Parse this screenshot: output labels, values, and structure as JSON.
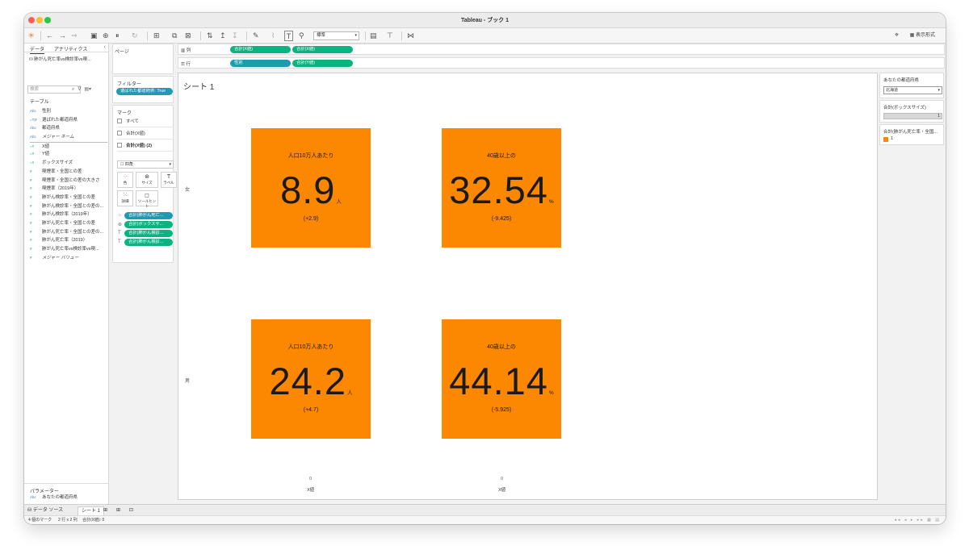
{
  "window": {
    "title": "Tableau - ブック 1"
  },
  "toolbar": {
    "font_select": "標準",
    "show_me": "表示形式"
  },
  "left": {
    "tabs": [
      "データ",
      "アナリティクス"
    ],
    "datasource": "肺がん死亡率vs検診率vs喫...",
    "search_placeholder": "検索",
    "table_title": "テーブル",
    "fields": [
      {
        "type": "Abc",
        "name": "性別"
      },
      {
        "type": "=T|F",
        "name": "選ばれた都道府県"
      },
      {
        "type": "Abc",
        "name": "都道府県"
      },
      {
        "type": "Abc",
        "name": "メジャー ネーム"
      },
      {
        "type": "=#",
        "name": "X値"
      },
      {
        "type": "=#",
        "name": "Y値"
      },
      {
        "type": "=#",
        "name": "ボックスサイズ"
      },
      {
        "type": "#",
        "name": "喫煙率・全国との差"
      },
      {
        "type": "#",
        "name": "喫煙率・全国との差の大きさ"
      },
      {
        "type": "#",
        "name": "喫煙率（2019年）"
      },
      {
        "type": "#",
        "name": "肺がん検診率・全国との差"
      },
      {
        "type": "#",
        "name": "肺がん検診率・全国との差の..."
      },
      {
        "type": "#",
        "name": "肺がん検診率（2019年）"
      },
      {
        "type": "#",
        "name": "肺がん死亡率・全国との差"
      },
      {
        "type": "#",
        "name": "肺がん死亡率・全国との差の..."
      },
      {
        "type": "#",
        "name": "肺がん死亡率（2019）"
      },
      {
        "type": "#",
        "name": "肺がん死亡率vs検診率vs喫..."
      },
      {
        "type": "#",
        "name": "メジャー バリュー"
      }
    ],
    "params_title": "パラメーター",
    "params": [
      {
        "type": "Abc",
        "name": "あなたの都道府県"
      }
    ]
  },
  "shelves": {
    "pages": "ページ",
    "filters_title": "フィルター",
    "filter_pill": "選ばれた都道府県: True",
    "marks_title": "マーク",
    "mark_rows": [
      "すべて",
      "合計(X値)",
      "合計(X値) (2)"
    ],
    "mark_type": "四角",
    "mark_buttons": [
      "色",
      "サイズ",
      "ラベル",
      "詳細",
      "ツールヒント"
    ],
    "mark_pills": [
      "合計(肺がん死亡...",
      "合計(ボックスサ...",
      "合計(肺がん検診...",
      "合計(肺がん検診..."
    ],
    "columns_label": "列",
    "rows_label": "行",
    "columns_pills": [
      "合計(X値)",
      "合計(X値)"
    ],
    "rows_pills": [
      "性別",
      "合計(Y値)"
    ]
  },
  "sheet": {
    "title": "シート 1",
    "row_labels": [
      "女",
      "男"
    ],
    "tiles": [
      {
        "caption": "人口10万人あたり",
        "value": "8.9",
        "unit": "人",
        "delta": "(+2.9)"
      },
      {
        "caption": "40歳以上の",
        "value": "32.54",
        "unit": "%",
        "delta": "(-9.425)"
      },
      {
        "caption": "人口10万人あたり",
        "value": "24.2",
        "unit": "人",
        "delta": "(+4.7)"
      },
      {
        "caption": "40歳以上の",
        "value": "44.14",
        "unit": "%",
        "delta": "(-5.925)"
      }
    ],
    "axis_zero": "0",
    "axis_label": "X値",
    "tile_color": "#fc8700"
  },
  "right": {
    "param_title": "あなたの都道府県",
    "param_value": "北海道",
    "size_title": "合計(ボックスサイズ)",
    "size_value": "1",
    "color_title": "合計(肺がん死亡率・全国...",
    "color_legend_value": "1"
  },
  "bottom": {
    "tabs": [
      "データ ソース",
      "シート 1"
    ]
  },
  "status": {
    "marks": "4 個のマーク",
    "grid": "2 行 x 2 列",
    "sum": "合計(X値): 0"
  }
}
